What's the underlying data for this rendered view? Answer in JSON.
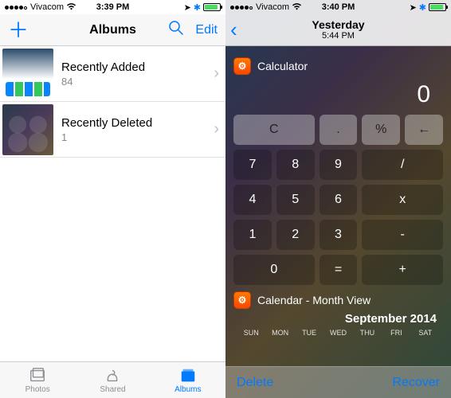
{
  "left": {
    "status": {
      "carrier": "Vivacom",
      "time": "3:39 PM"
    },
    "nav": {
      "title": "Albums",
      "edit": "Edit"
    },
    "albums": [
      {
        "name": "Recently Added",
        "count": "84"
      },
      {
        "name": "Recently Deleted",
        "count": "1"
      }
    ],
    "tabs": {
      "photos": "Photos",
      "shared": "Shared",
      "albums": "Albums"
    }
  },
  "right": {
    "status": {
      "carrier": "Vivacom",
      "time": "3:40 PM"
    },
    "nav": {
      "title": "Yesterday",
      "subtitle": "5:44 PM"
    },
    "calc": {
      "title": "Calculator",
      "display": "0",
      "rows": {
        "r1": {
          "c1": "C",
          "c2": ".",
          "c3": "%",
          "c4": "←"
        },
        "r2": {
          "c1": "7",
          "c2": "8",
          "c3": "9",
          "c4": "/"
        },
        "r3": {
          "c1": "4",
          "c2": "5",
          "c3": "6",
          "c4": "x"
        },
        "r4": {
          "c1": "1",
          "c2": "2",
          "c3": "3",
          "c4": "-"
        },
        "r5": {
          "c1": "0",
          "c2": "=",
          "c3": "+"
        }
      }
    },
    "calendar": {
      "title": "Calendar - Month View",
      "month": "September 2014",
      "days": {
        "d1": "SUN",
        "d2": "MON",
        "d3": "TUE",
        "d4": "WED",
        "d5": "THU",
        "d6": "FRI",
        "d7": "SAT"
      }
    },
    "bottom": {
      "delete": "Delete",
      "recover": "Recover"
    }
  }
}
